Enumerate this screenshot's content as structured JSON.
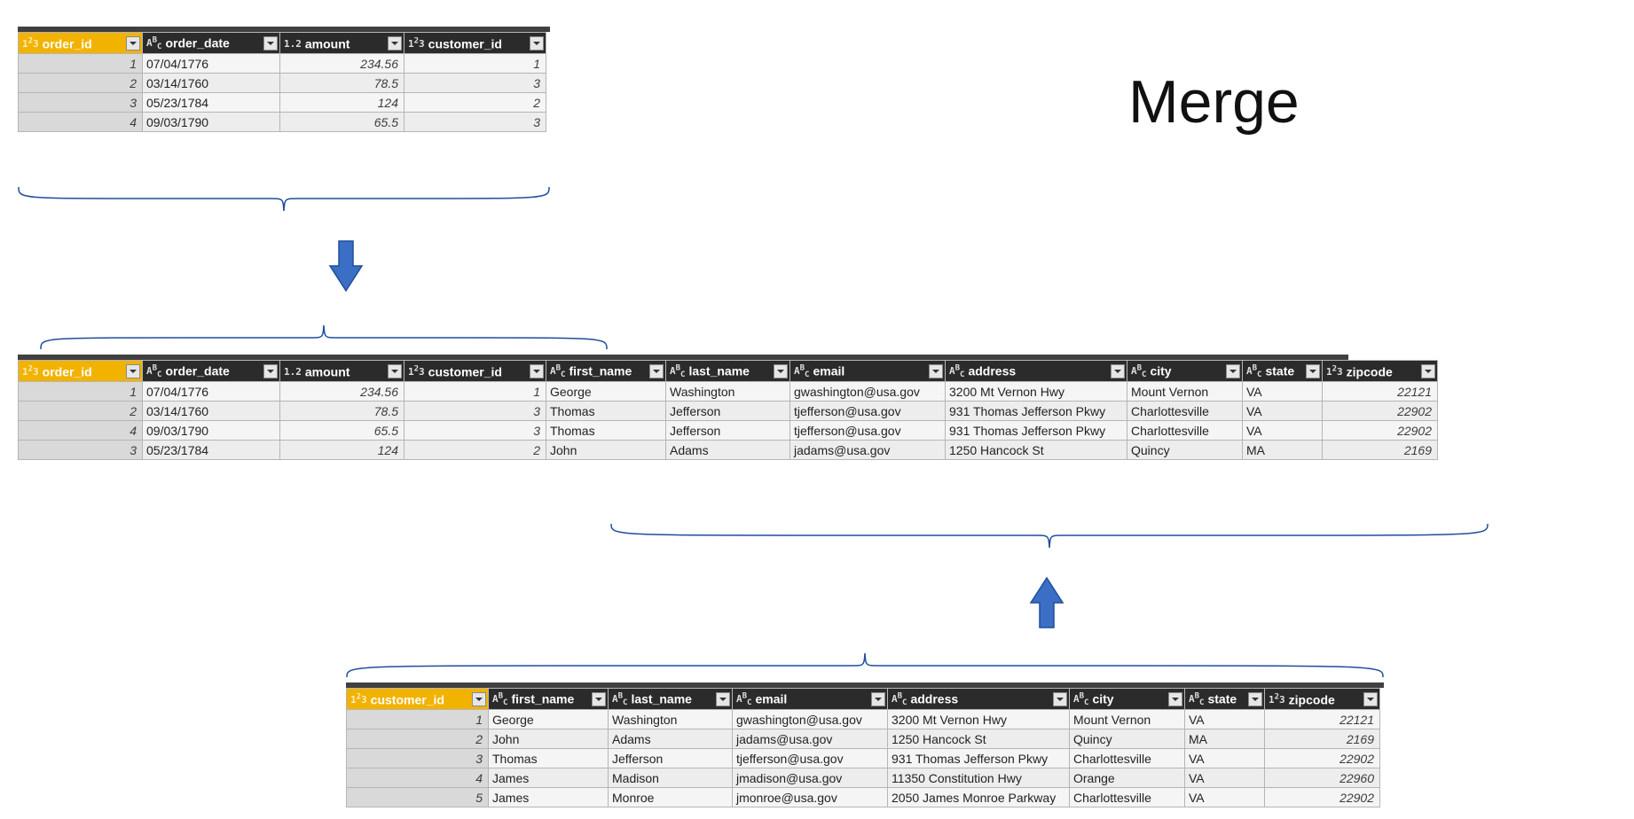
{
  "title": "Merge",
  "typeIcons": {
    "int": "1²₃",
    "text": "AᴮC",
    "dec": "1.2"
  },
  "tables": {
    "orders": {
      "columns": [
        {
          "name": "order_id",
          "type": "int",
          "key": true
        },
        {
          "name": "order_date",
          "type": "text",
          "key": false
        },
        {
          "name": "amount",
          "type": "dec",
          "key": false
        },
        {
          "name": "customer_id",
          "type": "int",
          "key": false
        }
      ],
      "rows": [
        {
          "idx": "1",
          "order_date": "07/04/1776",
          "amount": "234.56",
          "customer_id": "1"
        },
        {
          "idx": "2",
          "order_date": "03/14/1760",
          "amount": "78.5",
          "customer_id": "3"
        },
        {
          "idx": "3",
          "order_date": "05/23/1784",
          "amount": "124",
          "customer_id": "2"
        },
        {
          "idx": "4",
          "order_date": "09/03/1790",
          "amount": "65.5",
          "customer_id": "3"
        }
      ]
    },
    "merged": {
      "columns": [
        {
          "name": "order_id",
          "type": "int",
          "key": true
        },
        {
          "name": "order_date",
          "type": "text",
          "key": false
        },
        {
          "name": "amount",
          "type": "dec",
          "key": false
        },
        {
          "name": "customer_id",
          "type": "int",
          "key": false
        },
        {
          "name": "first_name",
          "type": "text",
          "key": false
        },
        {
          "name": "last_name",
          "type": "text",
          "key": false
        },
        {
          "name": "email",
          "type": "text",
          "key": false
        },
        {
          "name": "address",
          "type": "text",
          "key": false
        },
        {
          "name": "city",
          "type": "text",
          "key": false
        },
        {
          "name": "state",
          "type": "text",
          "key": false
        },
        {
          "name": "zipcode",
          "type": "int",
          "key": false
        }
      ],
      "rows": [
        {
          "idx": "1",
          "order_date": "07/04/1776",
          "amount": "234.56",
          "customer_id": "1",
          "first_name": "George",
          "last_name": "Washington",
          "email": "gwashington@usa.gov",
          "address": "3200 Mt Vernon Hwy",
          "city": "Mount Vernon",
          "state": "VA",
          "zipcode": "22121"
        },
        {
          "idx": "2",
          "order_date": "03/14/1760",
          "amount": "78.5",
          "customer_id": "3",
          "first_name": "Thomas",
          "last_name": "Jefferson",
          "email": "tjefferson@usa.gov",
          "address": "931 Thomas Jefferson Pkwy",
          "city": "Charlottesville",
          "state": "VA",
          "zipcode": "22902"
        },
        {
          "idx": "4",
          "order_date": "09/03/1790",
          "amount": "65.5",
          "customer_id": "3",
          "first_name": "Thomas",
          "last_name": "Jefferson",
          "email": "tjefferson@usa.gov",
          "address": "931 Thomas Jefferson Pkwy",
          "city": "Charlottesville",
          "state": "VA",
          "zipcode": "22902"
        },
        {
          "idx": "3",
          "order_date": "05/23/1784",
          "amount": "124",
          "customer_id": "2",
          "first_name": "John",
          "last_name": "Adams",
          "email": "jadams@usa.gov",
          "address": "1250 Hancock St",
          "city": "Quincy",
          "state": "MA",
          "zipcode": "2169"
        }
      ]
    },
    "customers": {
      "columns": [
        {
          "name": "customer_id",
          "type": "int",
          "key": true
        },
        {
          "name": "first_name",
          "type": "text",
          "key": false
        },
        {
          "name": "last_name",
          "type": "text",
          "key": false
        },
        {
          "name": "email",
          "type": "text",
          "key": false
        },
        {
          "name": "address",
          "type": "text",
          "key": false
        },
        {
          "name": "city",
          "type": "text",
          "key": false
        },
        {
          "name": "state",
          "type": "text",
          "key": false
        },
        {
          "name": "zipcode",
          "type": "int",
          "key": false
        }
      ],
      "rows": [
        {
          "idx": "1",
          "first_name": "George",
          "last_name": "Washington",
          "email": "gwashington@usa.gov",
          "address": "3200 Mt Vernon Hwy",
          "city": "Mount Vernon",
          "state": "VA",
          "zipcode": "22121"
        },
        {
          "idx": "2",
          "first_name": "John",
          "last_name": "Adams",
          "email": "jadams@usa.gov",
          "address": "1250 Hancock St",
          "city": "Quincy",
          "state": "MA",
          "zipcode": "2169"
        },
        {
          "idx": "3",
          "first_name": "Thomas",
          "last_name": "Jefferson",
          "email": "tjefferson@usa.gov",
          "address": "931 Thomas Jefferson Pkwy",
          "city": "Charlottesville",
          "state": "VA",
          "zipcode": "22902"
        },
        {
          "idx": "4",
          "first_name": "James",
          "last_name": "Madison",
          "email": "jmadison@usa.gov",
          "address": "11350 Constitution Hwy",
          "city": "Orange",
          "state": "VA",
          "zipcode": "22960"
        },
        {
          "idx": "5",
          "first_name": "James",
          "last_name": "Monroe",
          "email": "jmonroe@usa.gov",
          "address": "2050 James Monroe Parkway",
          "city": "Charlottesville",
          "state": "VA",
          "zipcode": "22902"
        }
      ]
    }
  },
  "columnWidths": {
    "order_id": 140,
    "order_date": 155,
    "amount": 140,
    "customer_id": 160,
    "first_name": 135,
    "last_name": 140,
    "email": 175,
    "address": 205,
    "city": 130,
    "state": 90,
    "zipcode": 130
  }
}
